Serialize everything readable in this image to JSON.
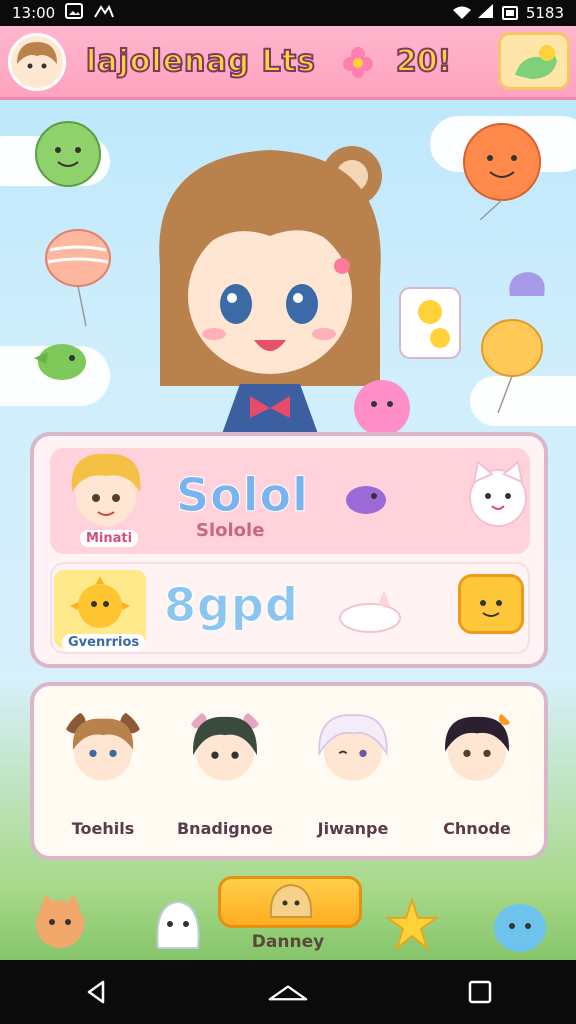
{
  "status_bar": {
    "time": "13:00",
    "right_text": "5183",
    "icons": [
      "image-icon",
      "share-icon",
      "wifi-icon",
      "signal-icon",
      "battery-icon"
    ]
  },
  "hud": {
    "title": "lajolenag Lts",
    "score": "20!"
  },
  "panel_top": {
    "row1": {
      "tag": "Minati",
      "big_text": "Solol",
      "label": "Slolole"
    },
    "row2": {
      "tag": "Gvenrrios",
      "big_text": "8gpd"
    }
  },
  "characters": [
    {
      "name": "Toehils"
    },
    {
      "name": "Bnadignoe"
    },
    {
      "name": "Jiwanpe"
    },
    {
      "name": "Chnode"
    }
  ],
  "play": {
    "label": "Danney"
  },
  "colors": {
    "hud_pink": "#ffa2bf",
    "gold_text": "#ffd23a",
    "panel_border": "#d9b7c8",
    "play_orange": "#ffad22"
  }
}
